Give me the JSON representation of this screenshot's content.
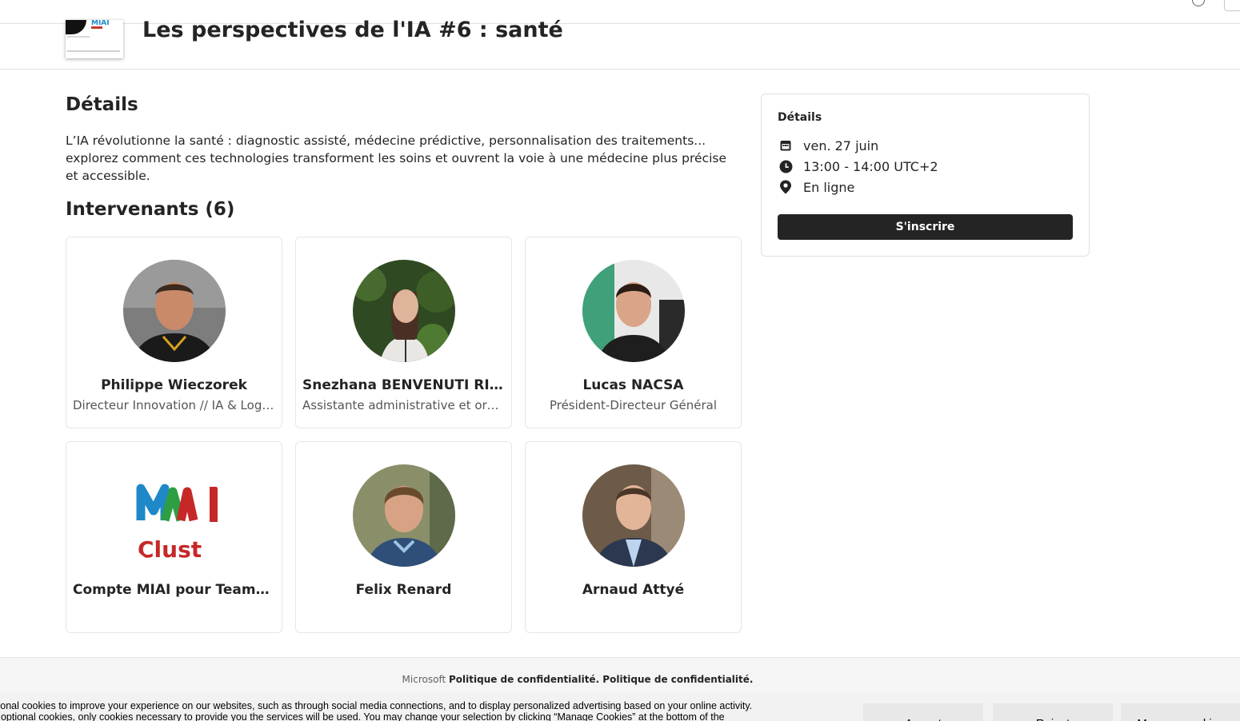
{
  "event": {
    "title": "Les perspectives de l'IA #6 : santé",
    "thumbnail_text": "MIAI"
  },
  "details": {
    "heading": "Détails",
    "description": "L’IA révolutionne la santé : diagnostic assisté, médecine prédictive, personnalisation des traitements... explorez comment ces technologies transforment les soins et ouvrent la voie à une médecine plus précise et accessible."
  },
  "speakers": {
    "heading": "Intervenants (6)",
    "items": [
      {
        "name": "Philippe Wieczorek",
        "role": "Directeur Innovation // IA & Logiciel"
      },
      {
        "name": "Snezhana BENVENUTI RIZZO",
        "role": "Assistante administrative et organisation"
      },
      {
        "name": "Lucas NACSA",
        "role": "Président-Directeur Général"
      },
      {
        "name": "Compte MIAI pour Teams Live",
        "role": "",
        "logo_text": "MI",
        "logo_subtext": "Clust"
      },
      {
        "name": "Felix Renard",
        "role": ""
      },
      {
        "name": "Arnaud Attyé",
        "role": ""
      }
    ]
  },
  "sidebar": {
    "title": "Détails",
    "date": "ven. 27 juin",
    "time": "13:00 - 14:00 UTC+2",
    "location": "En ligne",
    "register_label": "S'inscrire",
    "icons": [
      "calendar-icon",
      "clock-icon",
      "location-pin-icon"
    ]
  },
  "footer": {
    "brand": "Microsoft",
    "privacy": "Politique de confidentialité. Politique de confidentialité."
  },
  "cookie_banner": {
    "line1": "tional cookies to improve your experience on our websites, such as through social media connections, and to display personalized advertising based on your online activity.",
    "line2": "t optional cookies, only cookies necessary to provide you the services will be used. You may change your selection by clicking “Manage Cookies” at the bottom of the",
    "accept_label": "Accept",
    "reject_label": "Reject",
    "manage_label": "Manage cookies"
  },
  "colors": {
    "text": "#242424",
    "button_dark": "#242424",
    "border": "#e0e0e0",
    "miai_blue": "#1e88c9",
    "miai_green": "#2e9e44",
    "miai_red": "#c62828"
  }
}
